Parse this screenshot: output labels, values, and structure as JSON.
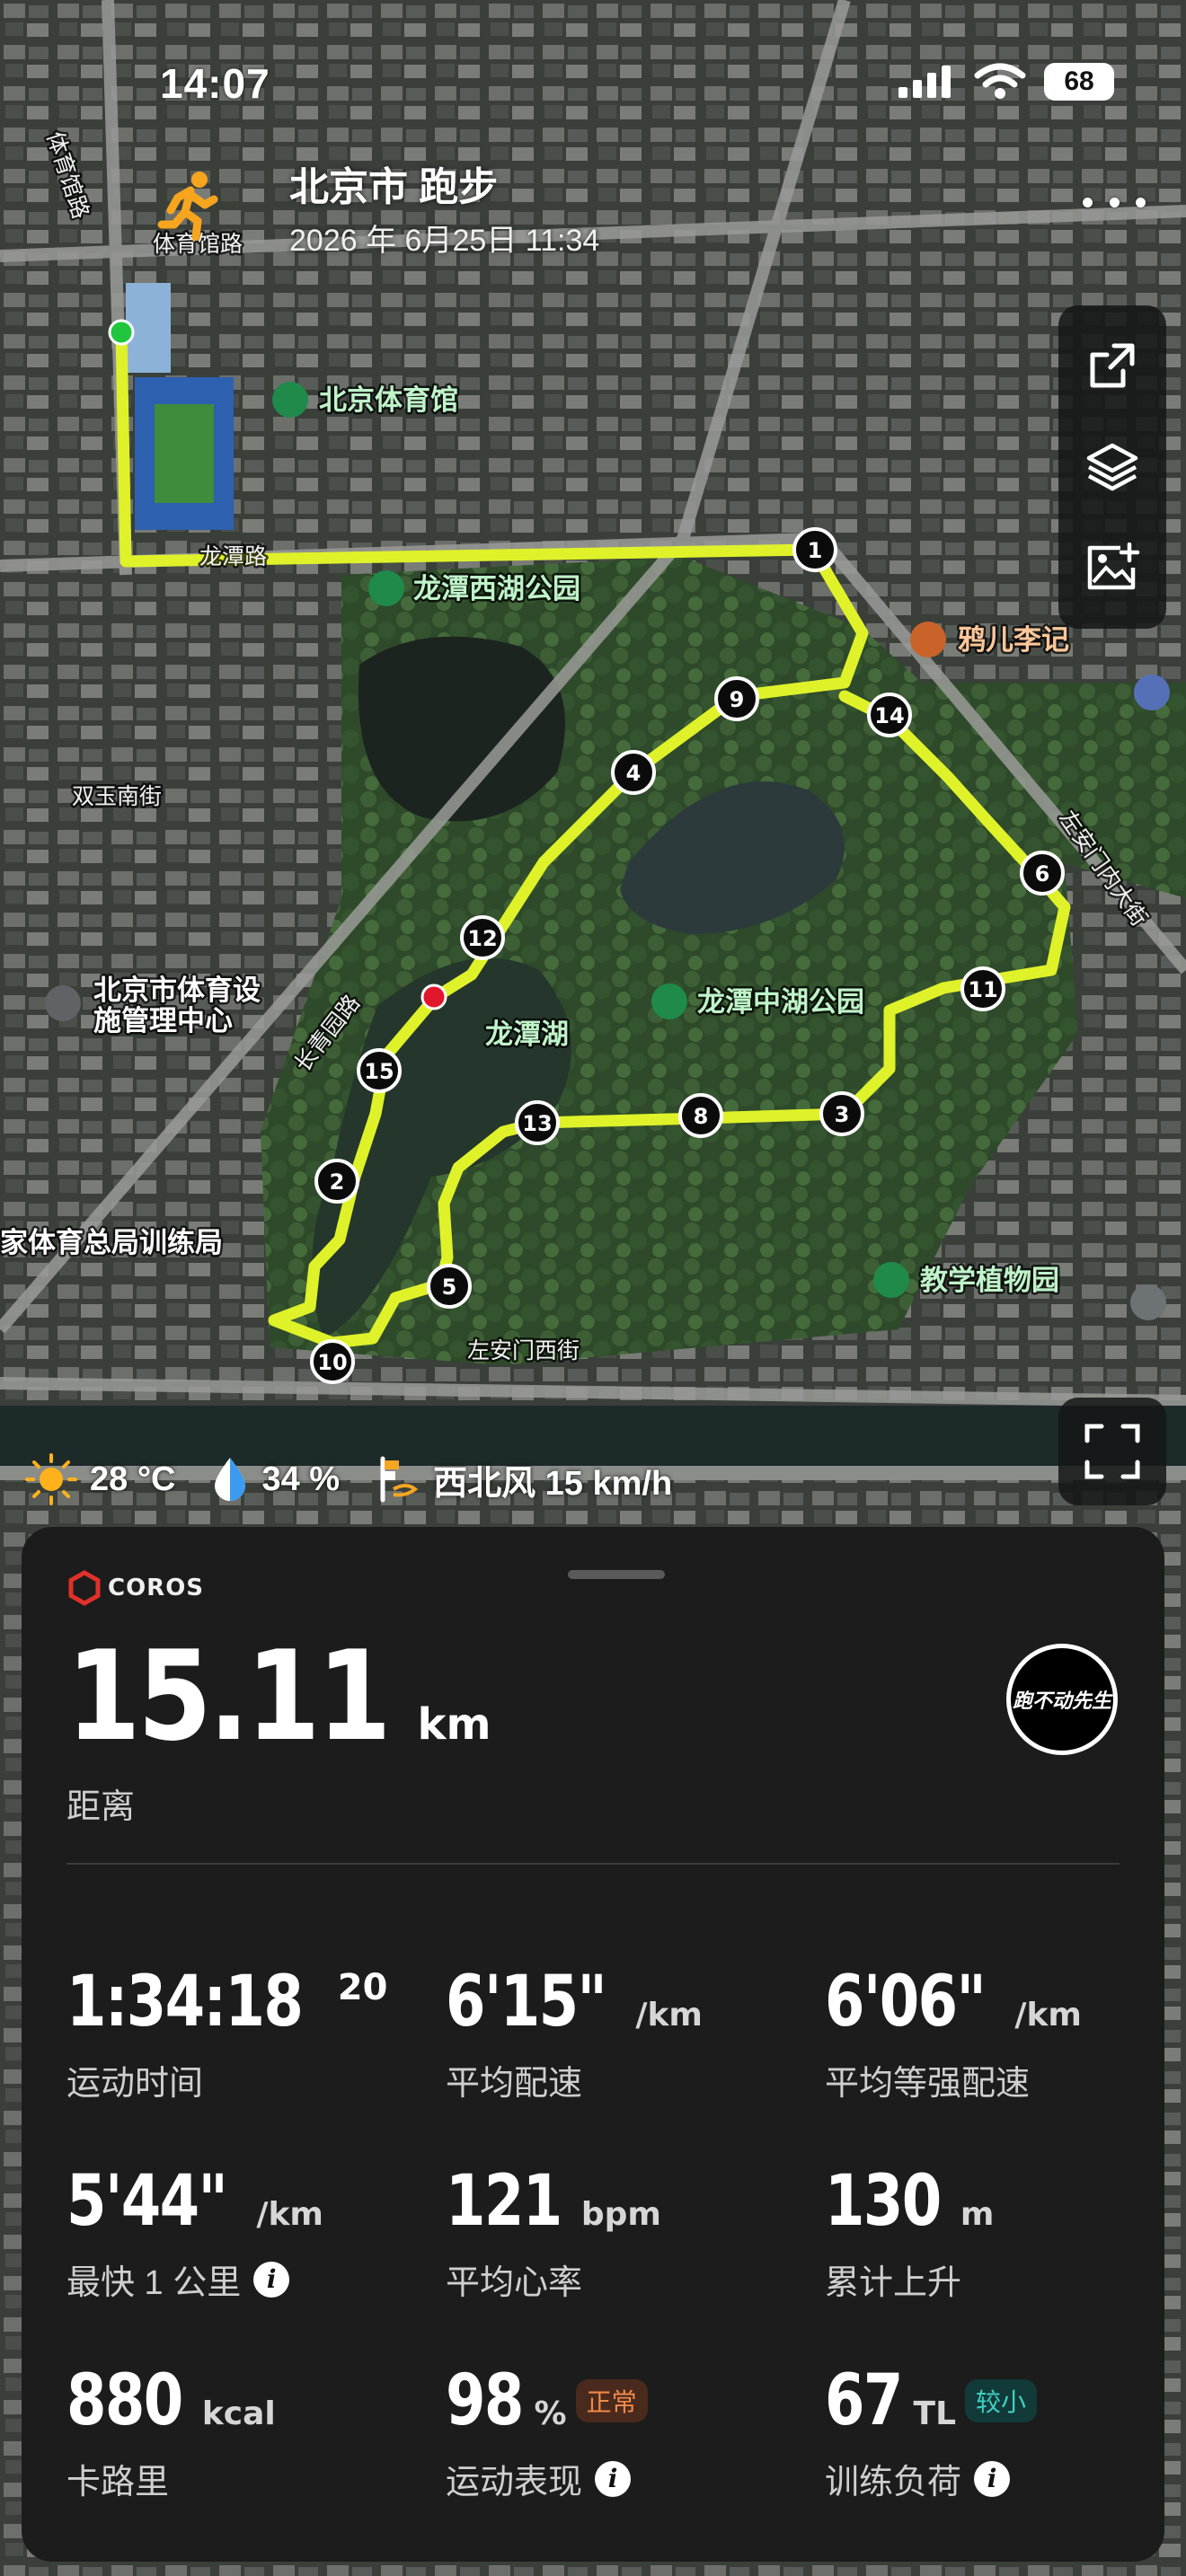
{
  "status_bar": {
    "time": "14:07",
    "battery": "68"
  },
  "header": {
    "title": "北京市 跑步",
    "datetime": "2026 年 6月25日 11:34",
    "activity_icon": "running-person-icon",
    "more_icon": "more-horizontal-icon"
  },
  "toolbar": {
    "share_icon": "share-icon",
    "layers_icon": "layers-icon",
    "add_image_icon": "add-image-icon",
    "fullscreen_icon": "fullscreen-icon"
  },
  "map": {
    "labels": {
      "stadium": "北京体育馆",
      "west_park": "龙潭西湖公园",
      "lake": "龙潭湖",
      "central_park": "龙潭中湖公园",
      "restaurant": "鸦儿李记",
      "botanical": "教学植物园",
      "facility_1": "北京市体育设",
      "facility_2": "施管理中心",
      "training": "家体育总局训练局",
      "road_tiyuguan": "体育馆路",
      "road_tiyuguan2": "体育馆路",
      "road_longtan": "龙潭路",
      "road_changqing": "长青园路",
      "road_shuangyu": "双玉南街",
      "road_zuoanmen_w": "左安门西街",
      "road_zuoanmen_n": "左安门内大街"
    },
    "route_color": "#dff229",
    "start_color": "#22c53e",
    "end_color": "#e2162b",
    "km_markers": [
      "1",
      "2",
      "3",
      "4",
      "5",
      "6",
      "8",
      "9",
      "10",
      "11",
      "12",
      "13",
      "14",
      "15"
    ]
  },
  "weather": {
    "temperature": "28 °C",
    "humidity": "34 %",
    "wind": "西北风 15 km/h",
    "icons": [
      "sun-icon",
      "droplet-icon",
      "wind-flag-icon"
    ]
  },
  "summary": {
    "brand": "COROS",
    "distance_value": "15.11",
    "distance_unit": "km",
    "distance_label": "距离",
    "avatar_text": "跑不动先生"
  },
  "metrics": [
    {
      "value": "1:34:18",
      "sup": "20",
      "unit": "",
      "label": "运动时间"
    },
    {
      "value": "6'15\"",
      "unit": "/km",
      "label": "平均配速"
    },
    {
      "value": "6'06\"",
      "unit": "/km",
      "label": "平均等强配速"
    },
    {
      "value": "5'44\"",
      "unit": "/km",
      "label": "最快 1 公里",
      "info": true
    },
    {
      "value": "121",
      "unit": "bpm",
      "label": "平均心率"
    },
    {
      "value": "130",
      "unit": "m",
      "label": "累计上升"
    },
    {
      "value": "880",
      "unit": "kcal",
      "label": "卡路里"
    },
    {
      "value": "98",
      "unit": "%",
      "label": "运动表现",
      "badge": "正常",
      "info": true
    },
    {
      "value": "67",
      "unit": "TL",
      "label": "训练负荷",
      "badge": "较小",
      "info": true
    }
  ]
}
